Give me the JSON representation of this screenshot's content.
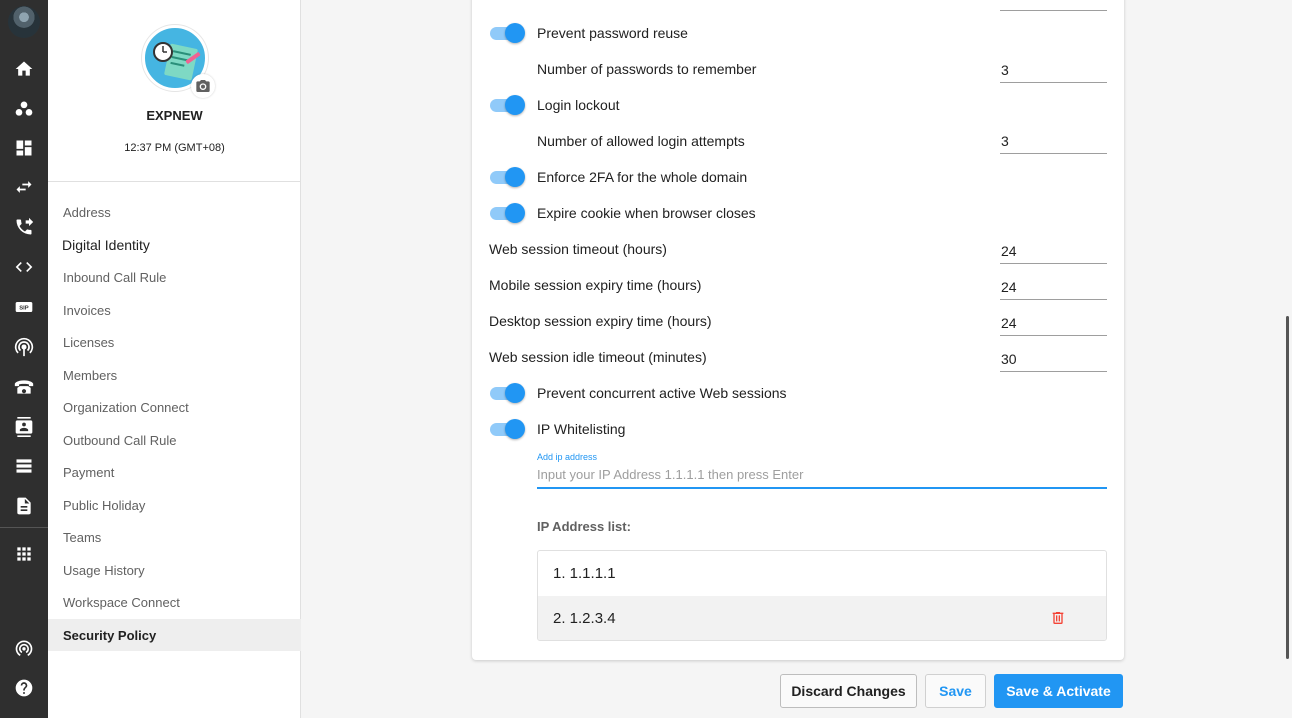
{
  "rail": {
    "icons": [
      "home-icon",
      "groups-icon",
      "dashboard-icon",
      "swap-icon",
      "phone-forward-icon",
      "code-icon",
      "sip-icon",
      "antenna-icon",
      "telephone-icon",
      "contact-icon",
      "list-icon",
      "document-icon",
      "apps-icon",
      "broadcast-icon",
      "help-icon"
    ],
    "sip_label": "SIP"
  },
  "profile": {
    "name": "EXPNEW",
    "time": "12:37 PM (GMT+08)"
  },
  "nav": {
    "items": [
      "Address",
      "Digital Identity",
      "Inbound Call Rule",
      "Invoices",
      "Licenses",
      "Members",
      "Organization Connect",
      "Outbound Call Rule",
      "Payment",
      "Public Holiday",
      "Teams",
      "Usage History",
      "Workspace Connect",
      "Security Policy"
    ],
    "active": "Security Policy"
  },
  "settings": {
    "prevent_password_reuse": {
      "label": "Prevent password reuse",
      "enabled": true
    },
    "passwords_to_remember": {
      "label": "Number of passwords to remember",
      "value": "3"
    },
    "login_lockout": {
      "label": "Login lockout",
      "enabled": true
    },
    "allowed_login_attempts": {
      "label": "Number of allowed login attempts",
      "value": "3"
    },
    "enforce_2fa": {
      "label": "Enforce 2FA for the whole domain",
      "enabled": true
    },
    "expire_cookie": {
      "label": "Expire cookie when browser closes",
      "enabled": true
    },
    "web_session_timeout": {
      "label": "Web session timeout (hours)",
      "value": "24"
    },
    "mobile_session_expiry": {
      "label": "Mobile session expiry time (hours)",
      "value": "24"
    },
    "desktop_session_expiry": {
      "label": "Desktop session expiry time (hours)",
      "value": "24"
    },
    "web_idle_timeout": {
      "label": "Web session idle timeout (minutes)",
      "value": "30"
    },
    "prevent_concurrent": {
      "label": "Prevent concurrent active Web sessions",
      "enabled": true
    },
    "ip_whitelisting": {
      "label": "IP Whitelisting",
      "enabled": true
    }
  },
  "ip": {
    "field_label": "Add ip address",
    "placeholder": "Input your IP Address 1.1.1.1 then press Enter",
    "list_title": "IP Address list:",
    "entries": [
      "1. 1.1.1.1",
      "2. 1.2.3.4"
    ]
  },
  "actions": {
    "discard": "Discard Changes",
    "save": "Save",
    "save_activate": "Save & Activate"
  },
  "colors": {
    "accent": "#2196f3",
    "rail_bg": "#2f2f2f",
    "delete": "#f44336"
  }
}
